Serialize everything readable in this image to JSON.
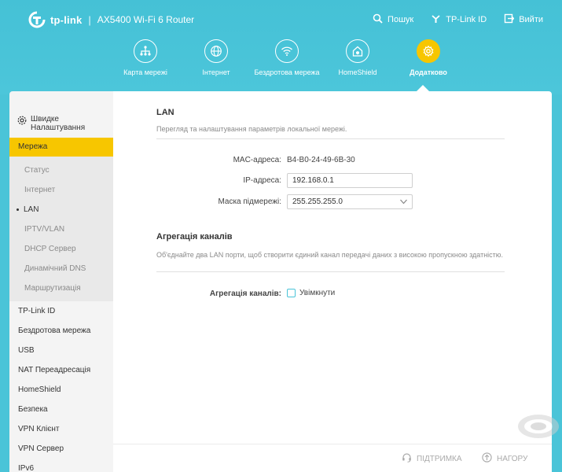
{
  "brand": {
    "name": "tp-link",
    "separator": "|",
    "model": "AX5400 Wi-Fi 6 Router"
  },
  "top_actions": [
    {
      "label": "Пошук",
      "icon": "search-icon"
    },
    {
      "label": "TP-Link ID",
      "icon": "tplink-id-icon"
    },
    {
      "label": "Вийти",
      "icon": "logout-icon"
    }
  ],
  "nav": [
    {
      "label": "Карта мережі",
      "icon": "network-map-icon"
    },
    {
      "label": "Інтернет",
      "icon": "globe-icon"
    },
    {
      "label": "Бездротова мережа",
      "icon": "wifi-icon"
    },
    {
      "label": "HomeShield",
      "icon": "home-shield-icon"
    },
    {
      "label": "Додатково",
      "icon": "gear-icon",
      "active": true
    }
  ],
  "sidebar": {
    "quick_setup": "Швидке Налаштування",
    "active_group": "Мережа",
    "sub_items": [
      "Статус",
      "Інтернет",
      "LAN",
      "IPTV/VLAN",
      "DHCP Сервер",
      "Динамічний DNS",
      "Маршрутизація"
    ],
    "current_sub": "LAN",
    "items": [
      "TP-Link ID",
      "Бездротова мережа",
      "USB",
      "NAT Переадресація",
      "HomeShield",
      "Безпека",
      "VPN Клієнт",
      "VPN Сервер",
      "IPv6"
    ]
  },
  "lan": {
    "title": "LAN",
    "description": "Перегляд та налаштування параметрів локальної мережі.",
    "mac_label": "MAC-адреса:",
    "mac_value": "B4-B0-24-49-6B-30",
    "ip_label": "IP-адреса:",
    "ip_value": "192.168.0.1",
    "mask_label": "Маска підмережі:",
    "mask_value": "255.255.255.0"
  },
  "aggregation": {
    "title": "Агрегація каналів",
    "description": "Об'єднайте два LAN порти, щоб створити єдиний канал передачі даних з високою пропускною здатністю.",
    "label": "Агрегація каналів:",
    "checkbox_label": "Увімкнути",
    "checked": false
  },
  "footer": {
    "support": "ПІДТРИМКА",
    "top": "НАГОРУ"
  },
  "colors": {
    "header": "#4ac4d8",
    "accent": "#f7c600"
  }
}
